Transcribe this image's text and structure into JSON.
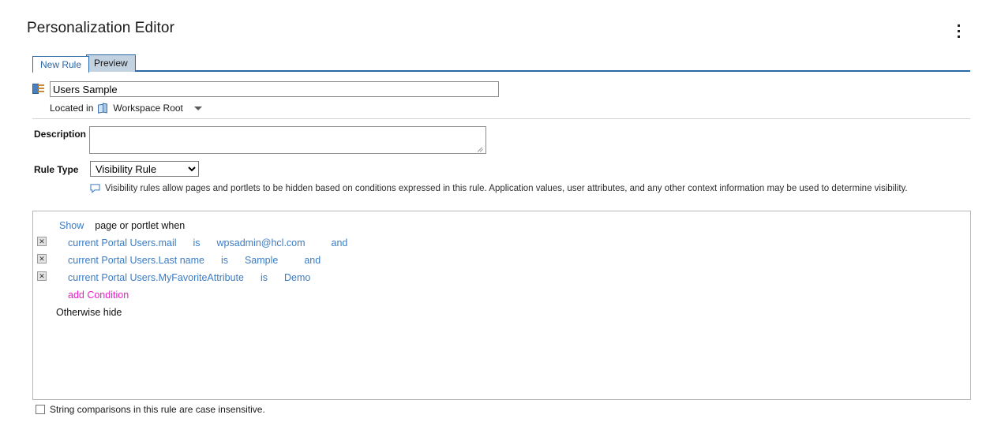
{
  "header": {
    "title": "Personalization Editor",
    "menu_icon": "kebab-menu-icon"
  },
  "tabs": [
    {
      "label": "New Rule",
      "active": true
    },
    {
      "label": "Preview",
      "active": false
    }
  ],
  "rule_name": {
    "icon": "rule-document-icon",
    "value": "Users Sample",
    "placeholder": ""
  },
  "located": {
    "label": "Located in",
    "icon": "workspace-icon",
    "value": "Workspace Root",
    "caret_icon": "chevron-down-icon"
  },
  "description": {
    "label": "Description",
    "value": "",
    "placeholder": ""
  },
  "rule_type": {
    "label": "Rule Type",
    "selected": "Visibility Rule",
    "options": [
      "Visibility Rule"
    ]
  },
  "help": {
    "icon": "speech-bubble-icon",
    "text": "Visibility rules allow pages and portlets to be hidden based on conditions expressed in this rule. Application values, user attributes, and any other context information may be used to determine visibility."
  },
  "rule_editor": {
    "action": "Show",
    "action_suffix": "page or portlet when",
    "delete_icon": "delete-condition-icon",
    "delete_glyph": "✕",
    "conditions": [
      {
        "attribute": "current Portal Users.mail",
        "operator": "is",
        "value": "wpsadmin@hcl.com",
        "connector": "and"
      },
      {
        "attribute": "current Portal Users.Last name",
        "operator": "is",
        "value": "Sample",
        "connector": "and"
      },
      {
        "attribute": "current Portal Users.MyFavoriteAttribute",
        "operator": "is",
        "value": "Demo",
        "connector": ""
      }
    ],
    "add_condition": "add Condition",
    "otherwise": "Otherwise hide"
  },
  "case_option": {
    "label": "String comparisons in this rule are case insensitive.",
    "checked": false
  },
  "colors": {
    "link_blue": "#3b7cc4",
    "tab_border": "#2a68a8",
    "tab_inactive_bg": "#c3d2e0",
    "pink_link": "#e81fc8",
    "panel_border": "#b6b6b6"
  }
}
